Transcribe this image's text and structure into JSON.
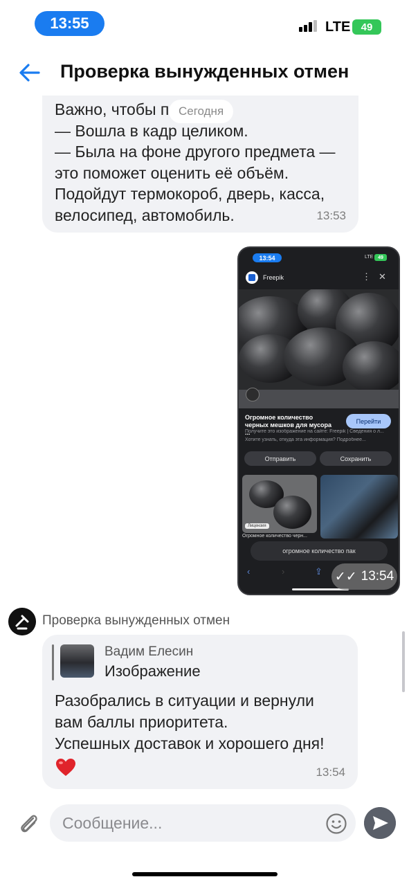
{
  "status": {
    "time": "13:55",
    "network": "LTE",
    "battery": "49"
  },
  "header": {
    "title": "Проверка вынужденных отмен"
  },
  "date_chip": "Сегодня",
  "messages": [
    {
      "text": "Важно, чтобы п\n— Вошла в кадр целиком.\n— Была на фоне другого предмета —\nэто поможет оценить её объём.\nПодойдут термокороб, дверь, касса,\nвелосипед, автомобиль.",
      "time": "13:53"
    },
    {
      "screenshot": {
        "time": "13:54",
        "network": "LTE",
        "battery": "49",
        "site": "Freepik",
        "caption": "Огромное количество черных мешков для мусора ...",
        "source_line": "Получите это изображение на сайте: Freepik | Сведения о л...",
        "info_line": "Хотите узнать, откуда эта информация? Подробнее...",
        "go_button": "Перейти",
        "share_button": "Отправить",
        "save_button": "Сохранить",
        "license_badge": "Лицензия",
        "thumb_caption": "Огромное количество черн...",
        "url": "огромное количество пак"
      },
      "time": "13:54"
    },
    {
      "sender": "Проверка вынужденных отмен",
      "quote": {
        "author": "Вадим Елесин",
        "text": "Изображение"
      },
      "text": "Разобрались в ситуации и вернули\nвам баллы приоритета.\nУспешных доставок и хорошего дня!",
      "reaction": "heart",
      "time": "13:54"
    }
  ],
  "composer": {
    "placeholder": "Сообщение..."
  },
  "colors": {
    "accent": "#1a7cf0",
    "bubble": "#f1f2f5",
    "battery": "#34c759"
  }
}
